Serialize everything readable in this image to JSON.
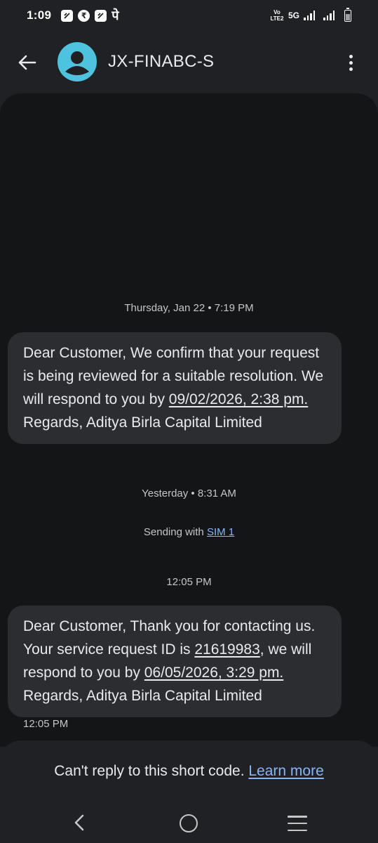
{
  "status_bar": {
    "time": "1:09",
    "notification_icons": [
      "app-icon",
      "rupee-icon",
      "app-icon",
      "phonepe-icon"
    ],
    "phonepe_glyph": "पे",
    "volte_label": "Vo LTE2",
    "network_label": "5G",
    "battery_icon": "battery-charging-icon"
  },
  "app_bar": {
    "title": "JX-FINABC-S",
    "back_icon": "arrow-back-icon",
    "avatar_icon": "person-icon",
    "avatar_color": "#4ec3e0",
    "menu_icon": "more-vert-icon"
  },
  "conversation": {
    "timestamp_1": "Thursday, Jan 22 • 7:19 PM",
    "message_1": {
      "text_a": "Dear Customer, We confirm that your request is being reviewed for a suitable resolution. We will respond to you by ",
      "link_date": "09/02/2026, 2:38 pm.",
      "text_b": " Regards, Aditya Birla Capital Limited"
    },
    "timestamp_2": "Yesterday • 8:31 AM",
    "sending_with": "Sending with ",
    "sim_label": "SIM 1",
    "timestamp_3": "12:05 PM",
    "message_2": {
      "text_a": "Dear Customer, Thank you for contacting us. Your service request ID is ",
      "link_id": "21619983",
      "text_b": ", we will respond to you by ",
      "link_date": "06/05/2026, 3:29 pm.",
      "text_c": " Regards, Aditya Birla Capital Limited",
      "time": "12:05 PM"
    }
  },
  "footer": {
    "message": "Can't reply to this short code. ",
    "learn_more": "Learn more"
  },
  "nav_bar": {
    "back_icon": "nav-back-icon",
    "home_icon": "nav-home-icon",
    "recents_icon": "nav-menu-icon"
  },
  "colors": {
    "background": "#202124",
    "panel": "#131517",
    "bubble": "#2c2d30",
    "link": "#8ab4f8"
  }
}
